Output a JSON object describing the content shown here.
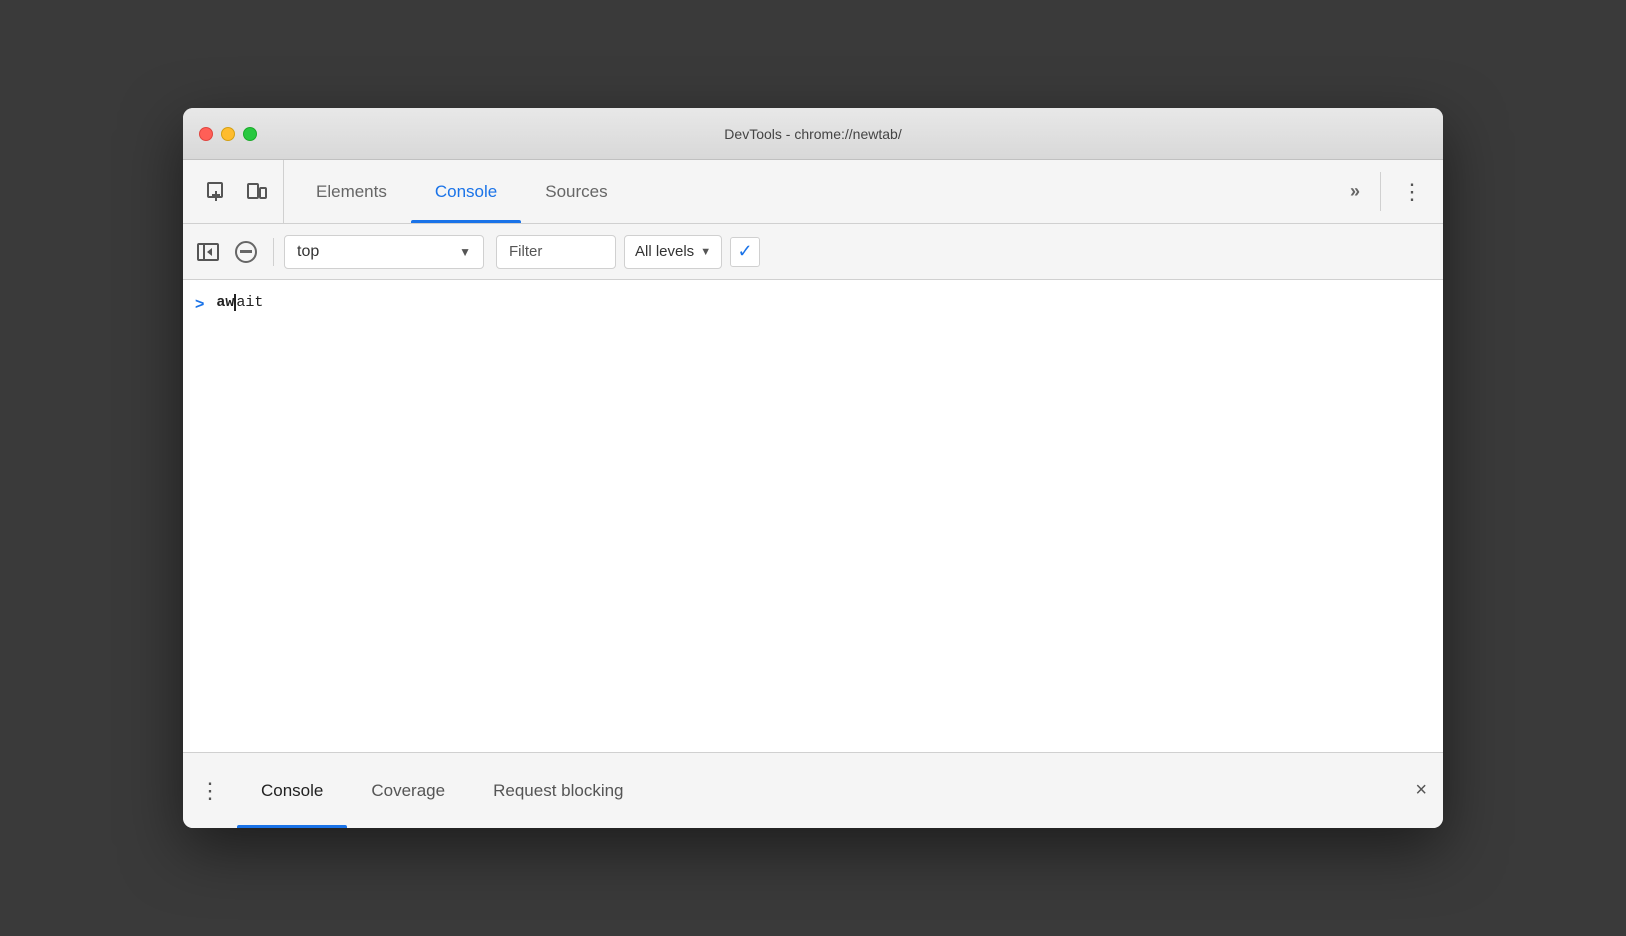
{
  "window": {
    "title": "DevTools - chrome://newtab/"
  },
  "traffic_lights": {
    "close_label": "close",
    "minimize_label": "minimize",
    "maximize_label": "maximize"
  },
  "devtools_tabs": {
    "tabs": [
      {
        "id": "elements",
        "label": "Elements",
        "active": false
      },
      {
        "id": "console",
        "label": "Console",
        "active": true
      },
      {
        "id": "sources",
        "label": "Sources",
        "active": false
      }
    ],
    "more_label": "»",
    "menu_label": "⋮"
  },
  "console_toolbar": {
    "context_value": "top",
    "context_arrow": "▼",
    "filter_placeholder": "Filter",
    "levels_label": "All levels",
    "levels_arrow": "▼",
    "checkbox_char": "✓"
  },
  "console_content": {
    "entry": {
      "chevron": ">",
      "bold_text": "aw",
      "light_text": "ait"
    }
  },
  "bottom_drawer": {
    "kebab": "⋮",
    "tabs": [
      {
        "id": "console",
        "label": "Console",
        "active": true
      },
      {
        "id": "coverage",
        "label": "Coverage",
        "active": false
      },
      {
        "id": "request-blocking",
        "label": "Request blocking",
        "active": false
      }
    ],
    "close_label": "×"
  }
}
